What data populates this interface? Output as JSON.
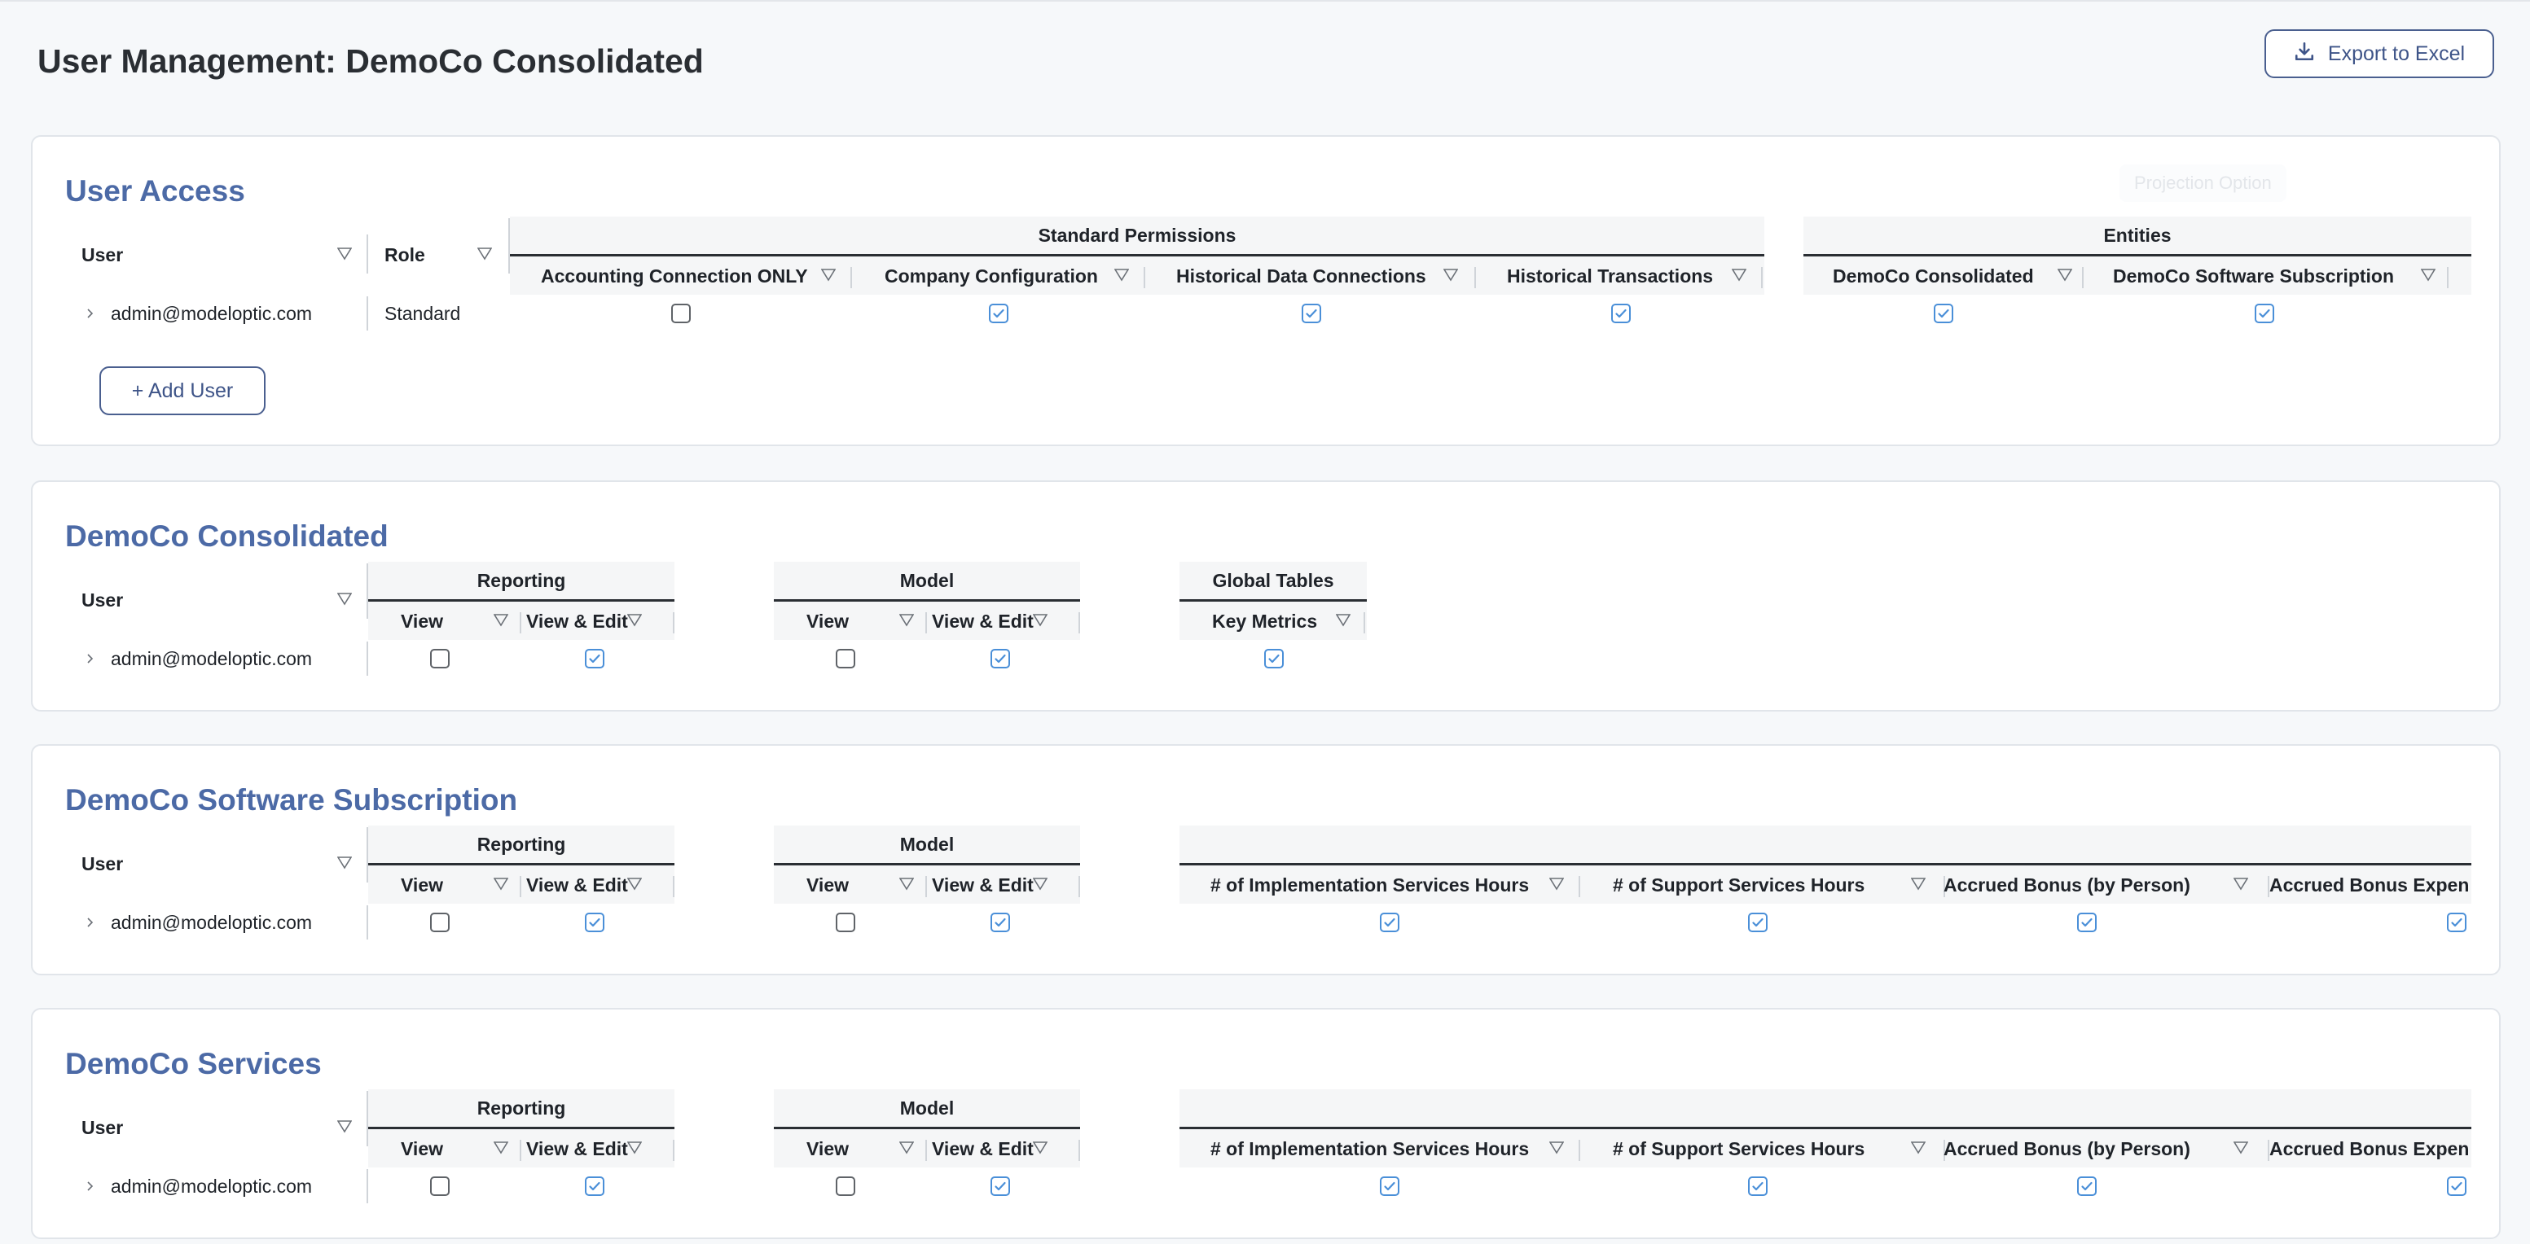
{
  "page": {
    "title": "User Management: DemoCo Consolidated",
    "export_label": "Export to Excel",
    "accent": "#4c6aa6",
    "checkbox_color": "#4a8fd8"
  },
  "user_access": {
    "title": "User Access",
    "ghost_text": "Projection Option",
    "col_user": "User",
    "col_role": "Role",
    "group_standard": "Standard Permissions",
    "group_entities": "Entities",
    "cols": [
      "Accounting Connection ONLY",
      "Company Configuration",
      "Historical Data Connections",
      "Historical Transactions",
      "DemoCo Consolidated",
      "DemoCo Software Subscription"
    ],
    "row": {
      "user": "admin@modeloptic.com",
      "role": "Standard",
      "checks": [
        false,
        true,
        true,
        true,
        true,
        true
      ]
    },
    "add_user_label": "+ Add User"
  },
  "sections": [
    {
      "title": "DemoCo Consolidated",
      "col_user": "User",
      "group_reporting": "Reporting",
      "group_model": "Model",
      "group_third": "Global Tables",
      "view": "View",
      "view_edit": "View & Edit",
      "third_cols": [
        "Key Metrics"
      ],
      "row": {
        "user": "admin@modeloptic.com",
        "checks": [
          false,
          true,
          false,
          true,
          true
        ]
      }
    },
    {
      "title": "DemoCo Software Subscription",
      "col_user": "User",
      "group_reporting": "Reporting",
      "group_model": "Model",
      "group_third": "",
      "view": "View",
      "view_edit": "View & Edit",
      "third_cols": [
        "# of Implementation Services Hours",
        "# of Support Services Hours",
        "Accrued Bonus (by Person)",
        "Accrued Bonus Expen"
      ],
      "row": {
        "user": "admin@modeloptic.com",
        "checks": [
          false,
          true,
          false,
          true,
          true,
          true,
          true,
          true
        ]
      }
    },
    {
      "title": "DemoCo Services",
      "col_user": "User",
      "group_reporting": "Reporting",
      "group_model": "Model",
      "group_third": "",
      "view": "View",
      "view_edit": "View & Edit",
      "third_cols": [
        "# of Implementation Services Hours",
        "# of Support Services Hours",
        "Accrued Bonus (by Person)",
        "Accrued Bonus Expen"
      ],
      "row": {
        "user": "admin@modeloptic.com",
        "checks": [
          false,
          true,
          false,
          true,
          true,
          true,
          true,
          true
        ]
      }
    }
  ]
}
